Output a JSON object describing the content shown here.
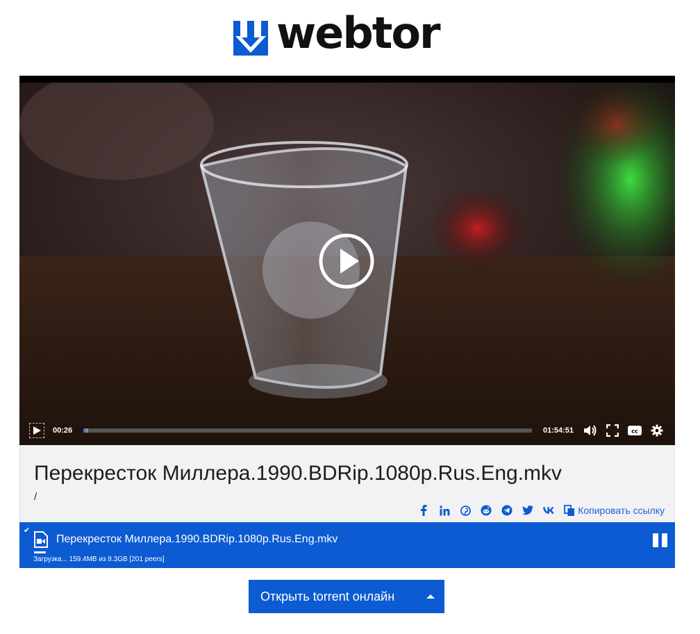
{
  "logo": {
    "text": "webtor",
    "icon": "download-arrow-icon",
    "brand_color": "#0c5bd2"
  },
  "player": {
    "current_time": "00:26",
    "duration": "01:54:51",
    "progress_fraction": 0.004,
    "buffered_fraction": 0.011,
    "big_play_icon": "play-circle-icon",
    "controls": [
      "play-icon",
      "volume-icon",
      "fullscreen-icon",
      "captions-icon",
      "settings-icon"
    ]
  },
  "info": {
    "title": "Перекресток Миллера.1990.BDRip.1080p.Rus.Eng.mkv",
    "path": "/",
    "share_icons": [
      "facebook-icon",
      "linkedin-icon",
      "pinterest-icon",
      "reddit-icon",
      "telegram-icon",
      "twitter-icon",
      "vk-icon"
    ],
    "copy_link_label": "Копировать ссылку"
  },
  "download": {
    "file_name": "Перекресток Миллера.1990.BDRip.1080p.Rus.Eng.mkv",
    "status": "Загрузка... 159.4MB из 8.3GB [201 peers]",
    "check_mark": "✔"
  },
  "actions": {
    "open_torrent_label": "Открыть torrent онлайн"
  },
  "colors": {
    "accent": "#0c5bd2",
    "link": "#1f5fd8",
    "info_bg": "#f2f2f4"
  }
}
